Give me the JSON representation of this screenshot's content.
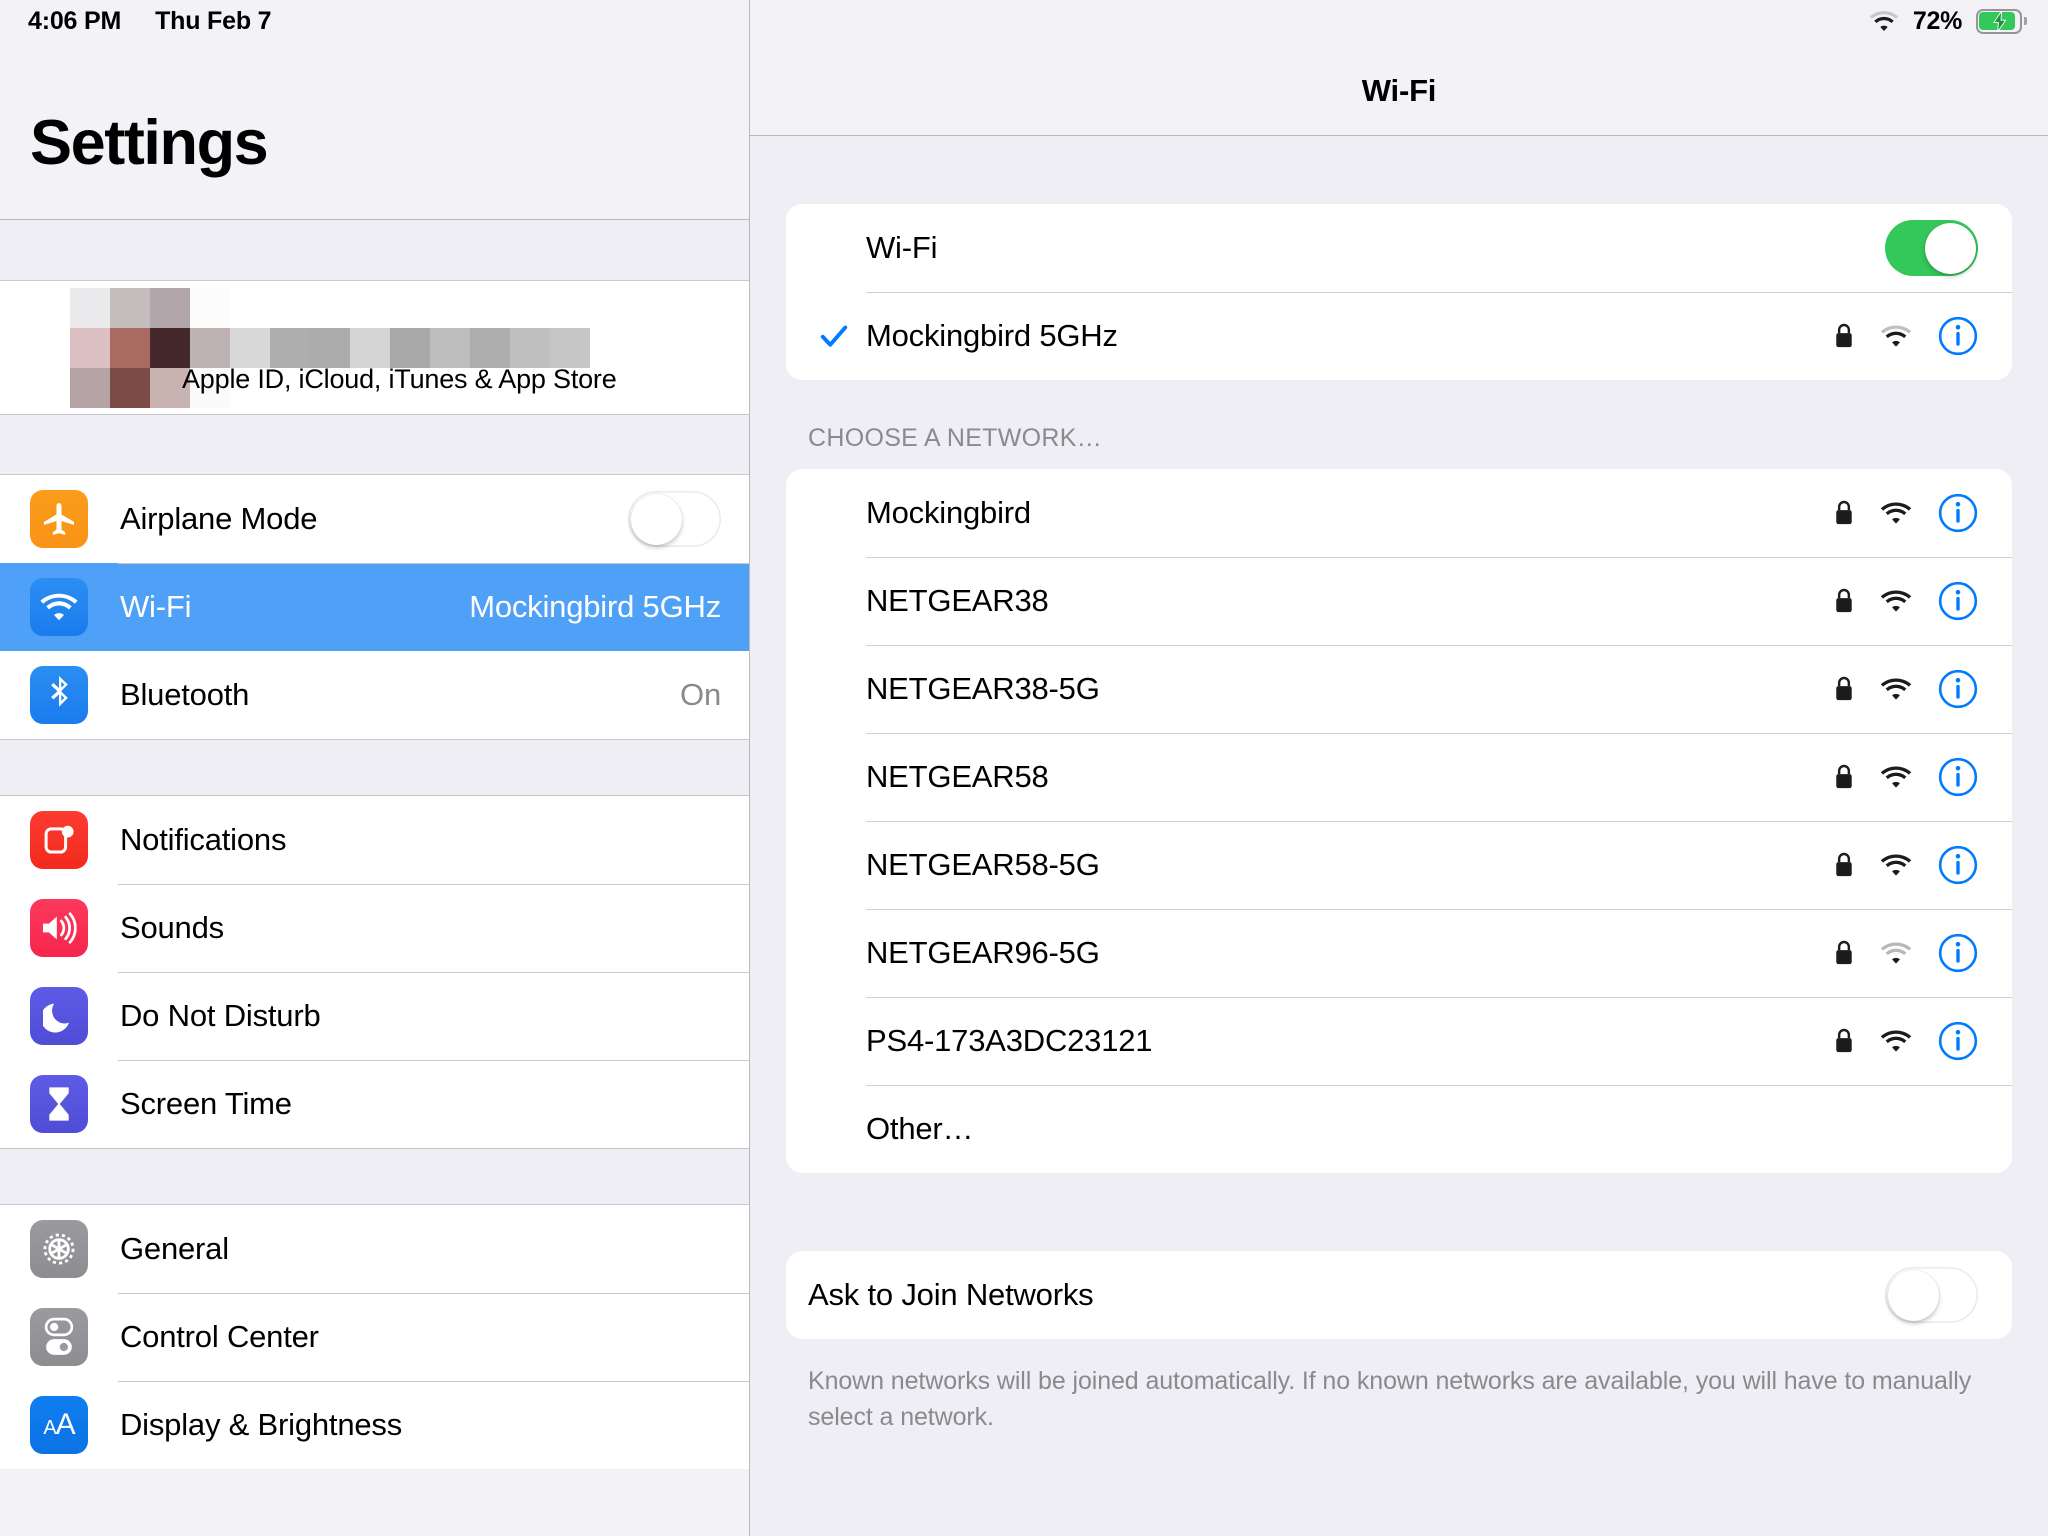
{
  "status_bar": {
    "time": "4:06 PM",
    "date": "Thu Feb 7",
    "battery_percent": "72%",
    "battery_level": 72,
    "charging": true,
    "wifi_icon": "wifi-icon",
    "battery_icon": "battery-charging-icon"
  },
  "sidebar": {
    "title": "Settings",
    "account": {
      "name_redacted": true,
      "subtitle": "Apple ID, iCloud, iTunes & App Store",
      "avatar_icon": "avatar-pixelated"
    },
    "groups": [
      {
        "items": [
          {
            "label": "Airplane Mode",
            "icon": "airplane-icon",
            "control": "toggle",
            "toggle_on": false,
            "selected": false
          },
          {
            "label": "Wi-Fi",
            "icon": "wifi-icon",
            "value": "Mockingbird 5GHz",
            "selected": true
          },
          {
            "label": "Bluetooth",
            "icon": "bluetooth-icon",
            "value": "On",
            "selected": false
          }
        ]
      },
      {
        "items": [
          {
            "label": "Notifications",
            "icon": "notifications-icon",
            "selected": false
          },
          {
            "label": "Sounds",
            "icon": "speaker-icon",
            "selected": false
          },
          {
            "label": "Do Not Disturb",
            "icon": "moon-icon",
            "selected": false
          },
          {
            "label": "Screen Time",
            "icon": "hourglass-icon",
            "selected": false
          }
        ]
      },
      {
        "items": [
          {
            "label": "General",
            "icon": "gear-icon",
            "selected": false
          },
          {
            "label": "Control Center",
            "icon": "sliders-icon",
            "selected": false
          },
          {
            "label": "Display & Brightness",
            "icon": "text-size-icon",
            "selected": false
          }
        ]
      }
    ]
  },
  "detail": {
    "nav_title": "Wi-Fi",
    "wifi_toggle": {
      "label": "Wi-Fi",
      "on": true
    },
    "connected_network": {
      "ssid": "Mockingbird 5GHz",
      "connected": true,
      "secured": true,
      "signal": 3,
      "info_icon": "info-circle-icon",
      "lock_icon": "lock-icon",
      "check_icon": "checkmark-icon"
    },
    "section_header": "CHOOSE A NETWORK…",
    "networks": [
      {
        "ssid": "Mockingbird",
        "secured": true,
        "signal": 3,
        "has_info": true
      },
      {
        "ssid": "NETGEAR38",
        "secured": true,
        "signal": 3,
        "has_info": true
      },
      {
        "ssid": "NETGEAR38-5G",
        "secured": true,
        "signal": 3,
        "has_info": true
      },
      {
        "ssid": "NETGEAR58",
        "secured": true,
        "signal": 3,
        "has_info": true
      },
      {
        "ssid": "NETGEAR58-5G",
        "secured": true,
        "signal": 3,
        "has_info": true
      },
      {
        "ssid": "NETGEAR96-5G",
        "secured": true,
        "signal": 2,
        "has_info": true
      },
      {
        "ssid": "PS4-173A3DC23121",
        "secured": true,
        "signal": 3,
        "has_info": true
      },
      {
        "ssid": "Other…",
        "secured": false,
        "signal": 0,
        "has_info": false
      }
    ],
    "ask_to_join": {
      "label": "Ask to Join Networks",
      "on": false
    },
    "footer_note": "Known networks will be joined automatically. If no known networks are available, you will have to manually select a network."
  },
  "colors": {
    "accent_blue": "#007aff",
    "selection_blue": "#4ea1f7",
    "toggle_green": "#34c759",
    "sidebar_bg": "#f3f3f7",
    "detail_bg": "#eeeef4",
    "card_bg": "#ffffff",
    "secondary_text": "#8a8a8e"
  }
}
